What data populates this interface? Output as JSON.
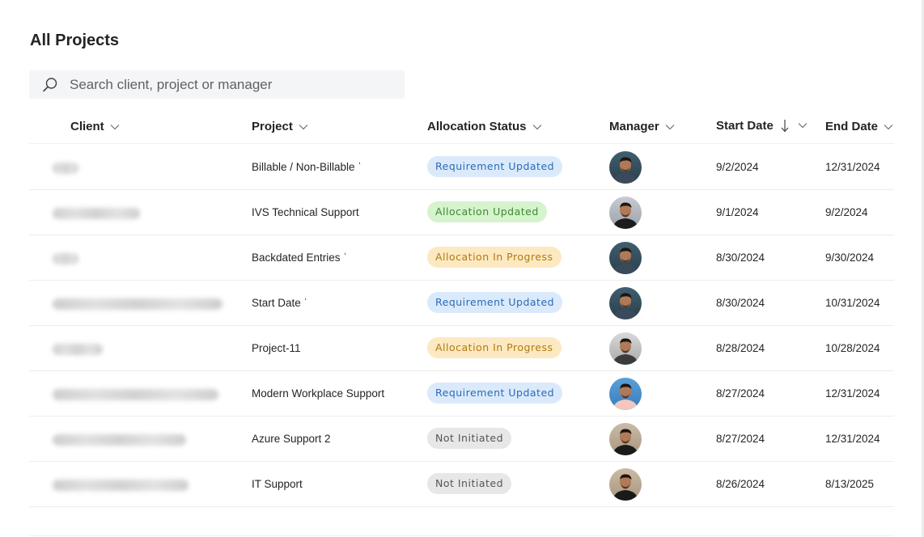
{
  "page": {
    "title": "All Projects"
  },
  "search": {
    "placeholder": "Search client, project or manager"
  },
  "columns": {
    "client": "Client",
    "project": "Project",
    "allocation_status": "Allocation Status",
    "manager": "Manager",
    "start_date": "Start Date",
    "end_date": "End Date"
  },
  "sort": {
    "column": "start_date",
    "direction": "descending"
  },
  "status_colors": {
    "Requirement Updated": {
      "bg": "#dbeafb",
      "fg": "#2a6bb5"
    },
    "Allocation Updated": {
      "bg": "#d5f3cd",
      "fg": "#3c8a2e"
    },
    "Allocation In Progress": {
      "bg": "#fde9c1",
      "fg": "#b07a10"
    },
    "Not Initiated": {
      "bg": "#e7e7e7",
      "fg": "#555555"
    }
  },
  "rows": [
    {
      "client": "",
      "client_redacted": true,
      "project": "Billable / Non-Billable ˈ",
      "status": "Requirement Updated",
      "manager_avatar": "avatar-photo-1",
      "start_date": "9/2/2024",
      "end_date": "12/31/2024"
    },
    {
      "client": "",
      "client_redacted": true,
      "project": "IVS Technical Support",
      "status": "Allocation Updated",
      "manager_avatar": "avatar-photo-2",
      "start_date": "9/1/2024",
      "end_date": "9/2/2024"
    },
    {
      "client": "",
      "client_redacted": true,
      "project": "Backdated Entries ˈ",
      "status": "Allocation In Progress",
      "manager_avatar": "avatar-photo-1",
      "start_date": "8/30/2024",
      "end_date": "9/30/2024"
    },
    {
      "client": "",
      "client_redacted": true,
      "project": "Start Date ˈ",
      "status": "Requirement Updated",
      "manager_avatar": "avatar-photo-1",
      "start_date": "8/30/2024",
      "end_date": "10/31/2024"
    },
    {
      "client": "",
      "client_redacted": true,
      "project": "Project-11",
      "status": "Allocation In Progress",
      "manager_avatar": "avatar-photo-3",
      "start_date": "8/28/2024",
      "end_date": "10/28/2024"
    },
    {
      "client": "",
      "client_redacted": true,
      "project": "Modern Workplace Support",
      "status": "Requirement Updated",
      "manager_avatar": "avatar-photo-4",
      "start_date": "8/27/2024",
      "end_date": "12/31/2024"
    },
    {
      "client": "",
      "client_redacted": true,
      "project": "Azure Support 2",
      "status": "Not Initiated",
      "manager_avatar": "avatar-photo-5",
      "start_date": "8/27/2024",
      "end_date": "12/31/2024"
    },
    {
      "client": "",
      "client_redacted": true,
      "project": "IT Support",
      "status": "Not Initiated",
      "manager_avatar": "avatar-photo-5",
      "start_date": "8/26/2024",
      "end_date": "8/13/2025"
    }
  ]
}
